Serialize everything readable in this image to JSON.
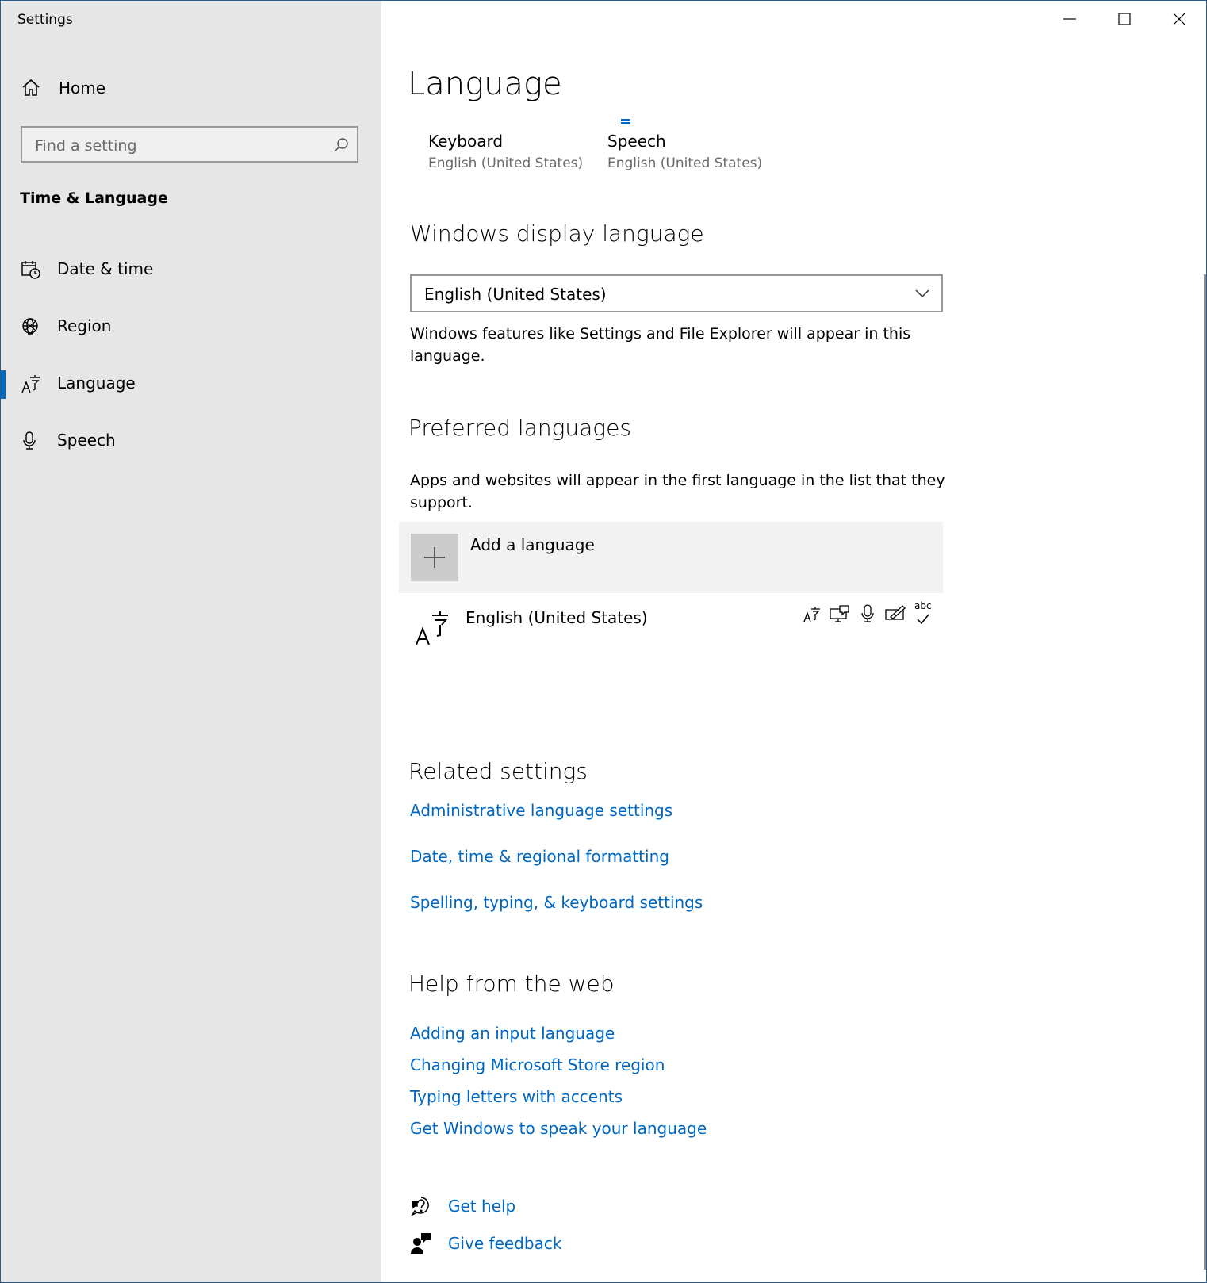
{
  "window": {
    "title": "Settings",
    "controls": [
      "minimize",
      "maximize",
      "close"
    ]
  },
  "sidebar": {
    "home_label": "Home",
    "search_placeholder": "Find a setting",
    "section_title": "Time & Language",
    "items": [
      {
        "label": "Date & time",
        "icon": "calendar-clock-icon",
        "active": false
      },
      {
        "label": "Region",
        "icon": "globe-icon",
        "active": false
      },
      {
        "label": "Language",
        "icon": "language-icon",
        "active": true
      },
      {
        "label": "Speech",
        "icon": "microphone-icon",
        "active": false
      }
    ]
  },
  "main": {
    "title": "Language",
    "quick_links": [
      {
        "title": "Keyboard",
        "subtitle": "English (United States)"
      },
      {
        "title": "Speech",
        "subtitle": "English (United States)"
      }
    ],
    "display_language": {
      "heading": "Windows display language",
      "selected": "English (United States)",
      "description": "Windows features like Settings and File Explorer will appear in this language."
    },
    "preferred": {
      "heading": "Preferred languages",
      "description": "Apps and websites will appear in the first language in the list that they support.",
      "add_label": "Add a language",
      "languages": [
        {
          "name": "English (United States)",
          "features": [
            "display-language-icon",
            "text-to-speech-icon",
            "speech-recognition-icon",
            "handwriting-icon",
            "spell-check-icon"
          ],
          "spell_check_text": "abc"
        }
      ]
    },
    "related": {
      "heading": "Related settings",
      "links": [
        "Administrative language settings",
        "Date, time & regional formatting",
        "Spelling, typing, & keyboard settings"
      ]
    },
    "help_web": {
      "heading": "Help from the web",
      "links": [
        "Adding an input language",
        "Changing Microsoft Store region",
        "Typing letters with accents",
        "Get Windows to speak your language"
      ]
    },
    "support": {
      "get_help": "Get help",
      "give_feedback": "Give feedback"
    }
  },
  "colors": {
    "accent": "#0067c0",
    "sidebar_bg": "#e6e6e6"
  }
}
